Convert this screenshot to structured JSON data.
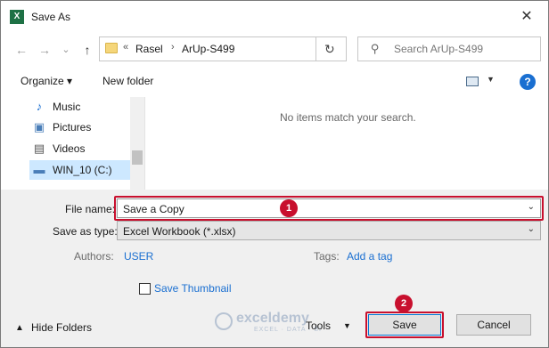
{
  "window": {
    "title": "Save As",
    "app_icon": "X",
    "close_glyph": "✕"
  },
  "nav": {
    "back_glyph": "←",
    "forward_glyph": "→",
    "caret_glyph": "⌄",
    "up_glyph": "↑",
    "breadcrumb_overflow": "«",
    "breadcrumbs": [
      "Rasel",
      "ArUp-S499"
    ],
    "breadcrumb_sep": "›",
    "address_caret": "⌄",
    "refresh_glyph": "↻",
    "search_placeholder": "Search ArUp-S499",
    "search_glyph": "⚲"
  },
  "toolbar": {
    "organize": "Organize ▾",
    "new_folder": "New folder",
    "view_caret": "▼",
    "help": "?"
  },
  "sidebar": {
    "items": [
      {
        "label": "Music",
        "icon": "♪"
      },
      {
        "label": "Pictures",
        "icon": "▣"
      },
      {
        "label": "Videos",
        "icon": "▤"
      },
      {
        "label": "WIN_10 (C:)",
        "icon": "▬"
      }
    ]
  },
  "content": {
    "empty_message": "No items match your search."
  },
  "form": {
    "file_name_label": "File name:",
    "file_name_value": "Save a Copy",
    "save_as_type_label": "Save as type:",
    "save_as_type_value": "Excel Workbook (*.xlsx)",
    "authors_label": "Authors:",
    "authors_value": "USER",
    "tags_label": "Tags:",
    "tags_value": "Add a tag",
    "save_thumbnail_label": "Save Thumbnail",
    "field_caret": "⌄"
  },
  "footer": {
    "hide_folders": "Hide Folders",
    "hide_caret": "▲",
    "tools": "Tools",
    "tools_caret": "▼",
    "save": "Save",
    "cancel": "Cancel"
  },
  "annotations": {
    "step1": "1",
    "step2": "2",
    "color": "#c8102e"
  },
  "watermark": {
    "brand": "exceldemy",
    "tagline": "EXCEL · DATA · BI"
  }
}
